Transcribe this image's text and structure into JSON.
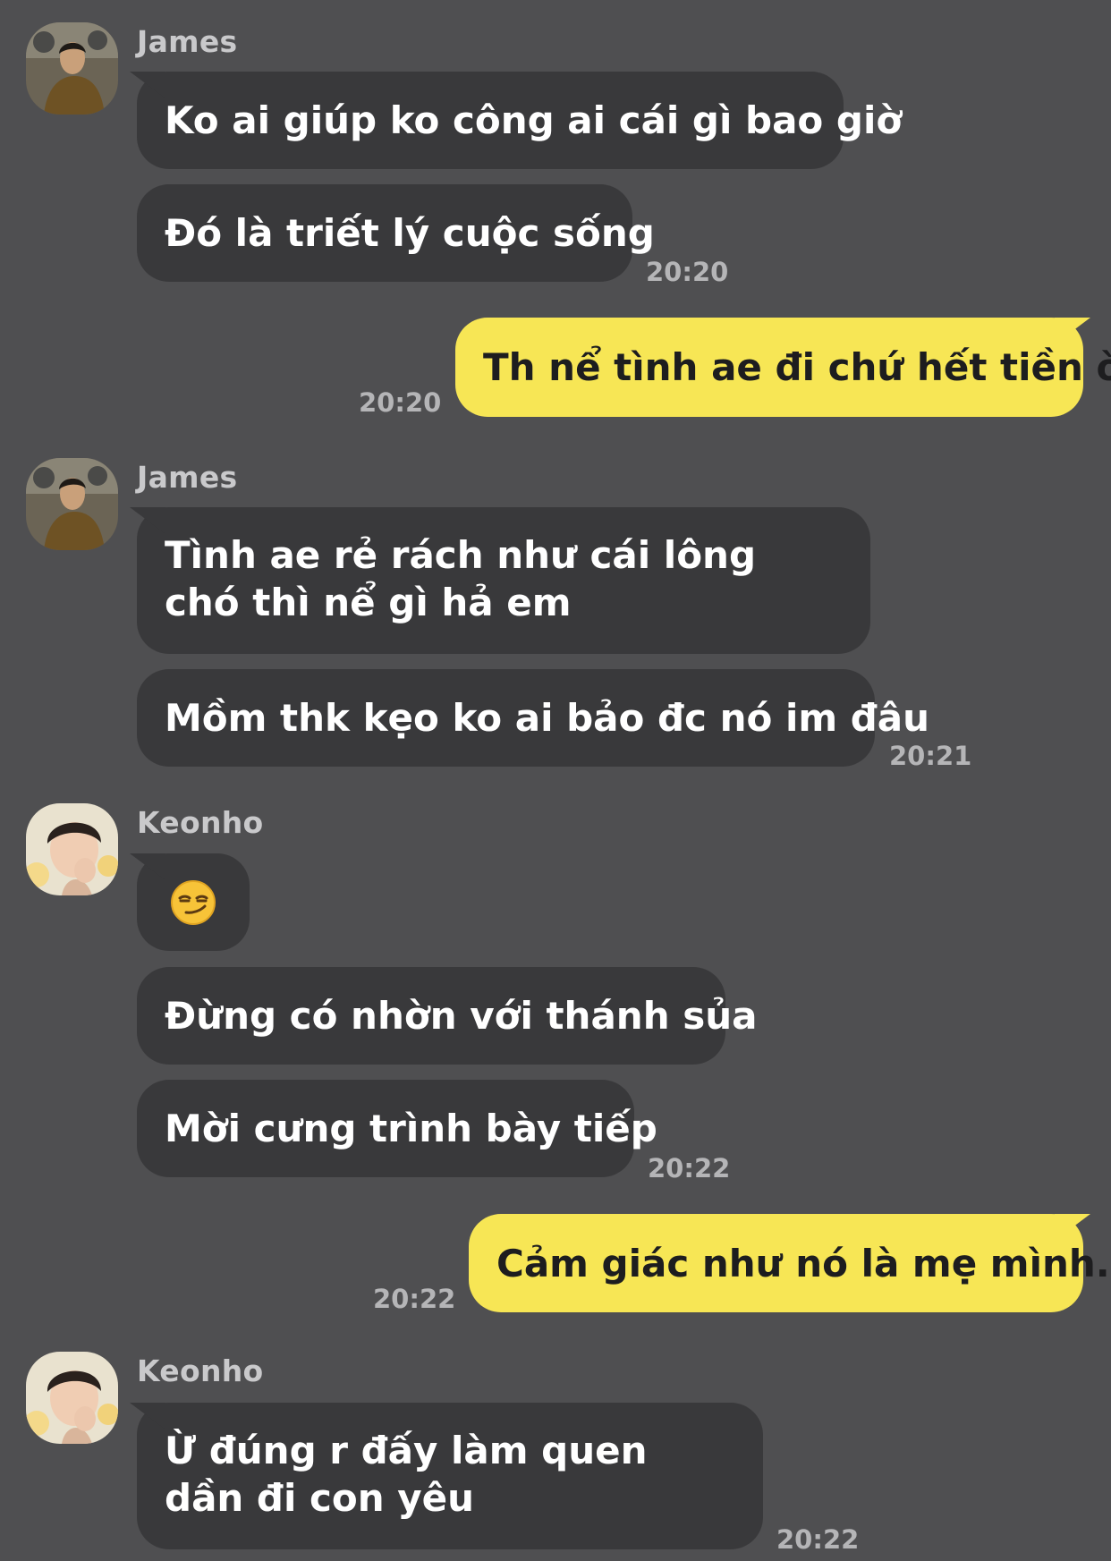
{
  "senders": {
    "james": "James",
    "keonho": "Keonho"
  },
  "messages": {
    "m1": "Ko ai giúp ko công ai cái gì bao giờ",
    "m2": "Đó là triết lý cuộc sống",
    "m3": "Th nể tình ae đi chứ hết tiền òi",
    "m4": "Tình ae rẻ rách như cái lông chó thì nể gì hả em",
    "m5": "Mồm thk kẹo ko ai bảo đc nó im đâu",
    "m6_emoji": "smirking-face-emoji",
    "m7": "Đừng có nhờn với thánh sủa",
    "m8": "Mời cưng trình bày tiếp",
    "m9": "Cảm giác như nó là mẹ mình..",
    "m10": "Ừ đúng r đấy làm quen dần đi con yêu"
  },
  "times": {
    "t1": "20:20",
    "t2": "20:20",
    "t3": "20:21",
    "t4": "20:22",
    "t5": "20:22",
    "t6": "20:22"
  },
  "colors": {
    "background": "#4f4f51",
    "incoming_bubble": "#39393b",
    "outgoing_bubble": "#f7e655",
    "timestamp": "#b5b5b7"
  }
}
